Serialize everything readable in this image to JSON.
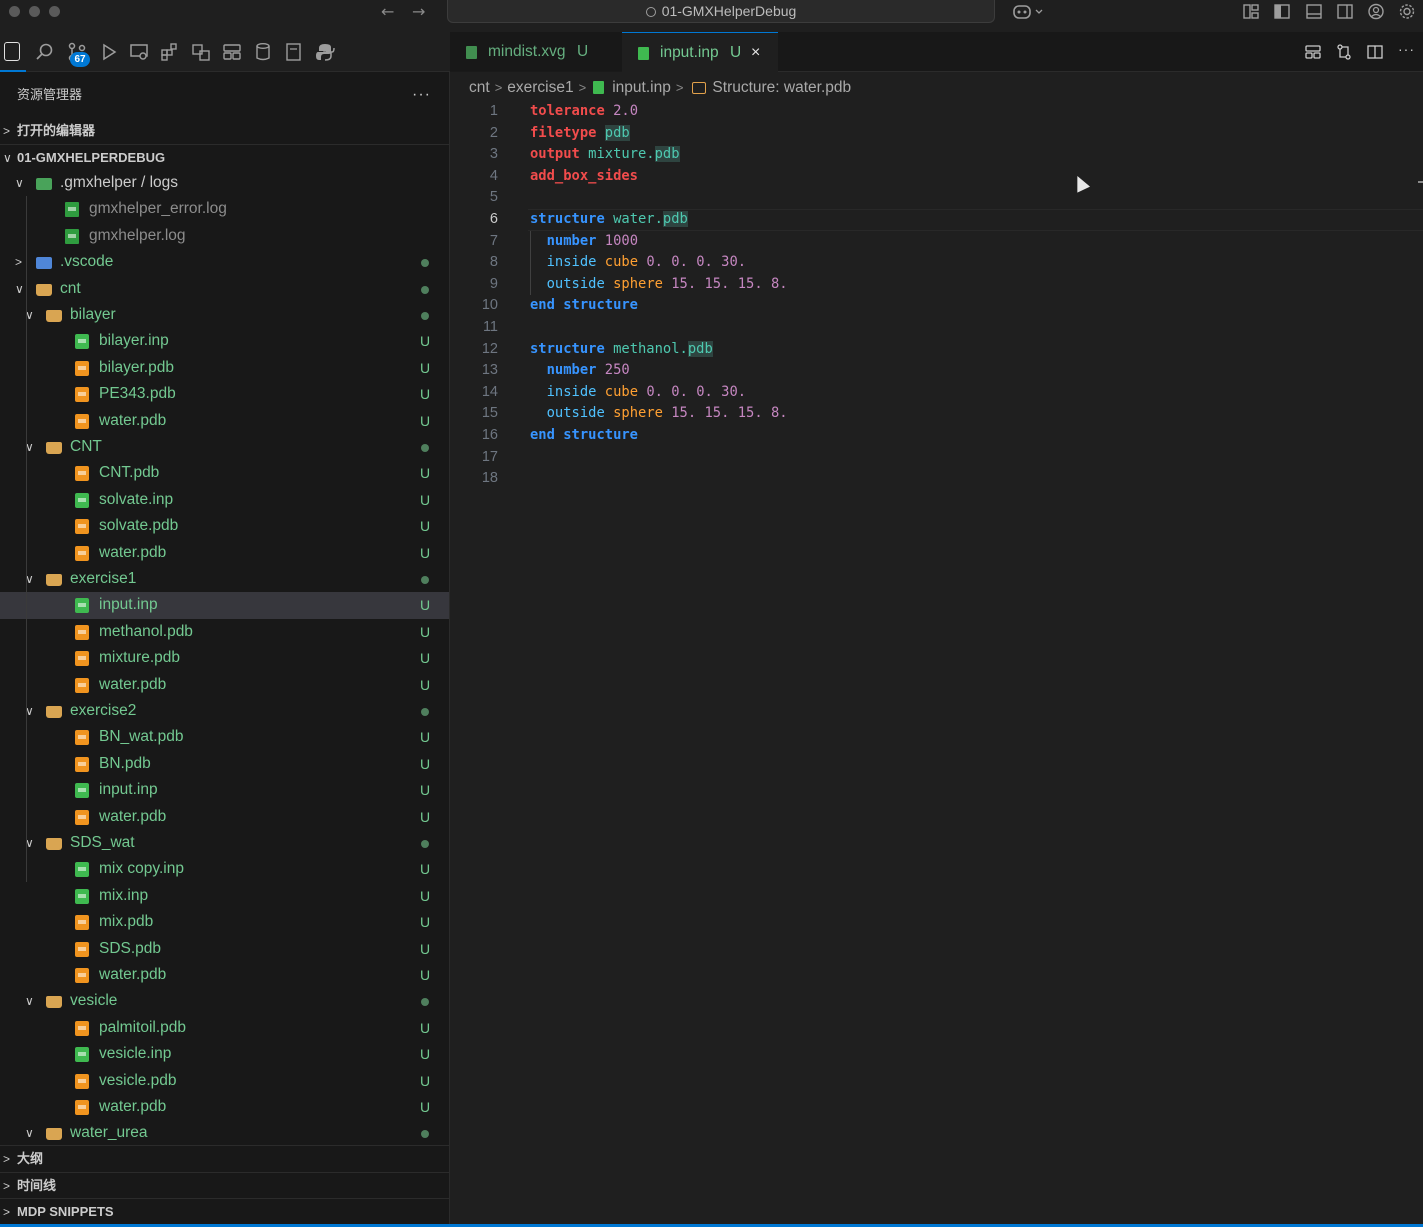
{
  "window": {
    "title": "01-GMXHelperDebug"
  },
  "activity_bar": {
    "source_control_badge": "67",
    "icons": [
      "files-icon",
      "search-icon",
      "source-control-icon",
      "run-debug-icon",
      "remote-explorer-icon",
      "extensions-icon",
      "testing-icon",
      "layout-icon",
      "database-icon",
      "notebook-icon",
      "python-icon"
    ]
  },
  "sidebar": {
    "title": "资源管理器",
    "more": "···",
    "open_editors": "打开的编辑器",
    "workspace": "01-GMXHELPERDEBUG",
    "tree": [
      {
        "label": ".gmxhelper / logs",
        "kind": "folder-green",
        "depth": 0,
        "expanded": true,
        "color": "plain"
      },
      {
        "label": "gmxhelper_error.log",
        "kind": "log",
        "depth": 1,
        "color": "gray"
      },
      {
        "label": "gmxhelper.log",
        "kind": "log",
        "depth": 1,
        "color": "gray"
      },
      {
        "label": ".vscode",
        "kind": "folder-blue",
        "depth": 0,
        "expanded": false,
        "color": "green",
        "dot": true
      },
      {
        "label": "cnt",
        "kind": "folder",
        "depth": 0,
        "expanded": true,
        "color": "green",
        "dot": true
      },
      {
        "label": "bilayer",
        "kind": "folder",
        "depth": 1,
        "expanded": true,
        "color": "green",
        "dot": true
      },
      {
        "label": "bilayer.inp",
        "kind": "inp",
        "depth": 2,
        "color": "green",
        "status": "U"
      },
      {
        "label": "bilayer.pdb",
        "kind": "pdb",
        "depth": 2,
        "color": "green",
        "status": "U"
      },
      {
        "label": "PE343.pdb",
        "kind": "pdb",
        "depth": 2,
        "color": "green",
        "status": "U"
      },
      {
        "label": "water.pdb",
        "kind": "pdb",
        "depth": 2,
        "color": "green",
        "status": "U"
      },
      {
        "label": "CNT",
        "kind": "folder",
        "depth": 1,
        "expanded": true,
        "color": "green",
        "dot": true
      },
      {
        "label": "CNT.pdb",
        "kind": "pdb",
        "depth": 2,
        "color": "green",
        "status": "U"
      },
      {
        "label": "solvate.inp",
        "kind": "inp",
        "depth": 2,
        "color": "green",
        "status": "U"
      },
      {
        "label": "solvate.pdb",
        "kind": "pdb",
        "depth": 2,
        "color": "green",
        "status": "U"
      },
      {
        "label": "water.pdb",
        "kind": "pdb",
        "depth": 2,
        "color": "green",
        "status": "U"
      },
      {
        "label": "exercise1",
        "kind": "folder",
        "depth": 1,
        "expanded": true,
        "color": "green",
        "dot": true
      },
      {
        "label": "input.inp",
        "kind": "inp",
        "depth": 2,
        "color": "green",
        "status": "U",
        "selected": true
      },
      {
        "label": "methanol.pdb",
        "kind": "pdb",
        "depth": 2,
        "color": "green",
        "status": "U"
      },
      {
        "label": "mixture.pdb",
        "kind": "pdb",
        "depth": 2,
        "color": "green",
        "status": "U"
      },
      {
        "label": "water.pdb",
        "kind": "pdb",
        "depth": 2,
        "color": "green",
        "status": "U"
      },
      {
        "label": "exercise2",
        "kind": "folder",
        "depth": 1,
        "expanded": true,
        "color": "green",
        "dot": true
      },
      {
        "label": "BN_wat.pdb",
        "kind": "pdb",
        "depth": 2,
        "color": "green",
        "status": "U"
      },
      {
        "label": "BN.pdb",
        "kind": "pdb",
        "depth": 2,
        "color": "green",
        "status": "U"
      },
      {
        "label": "input.inp",
        "kind": "inp",
        "depth": 2,
        "color": "green",
        "status": "U"
      },
      {
        "label": "water.pdb",
        "kind": "pdb",
        "depth": 2,
        "color": "green",
        "status": "U"
      },
      {
        "label": "SDS_wat",
        "kind": "folder",
        "depth": 1,
        "expanded": true,
        "color": "green",
        "dot": true
      },
      {
        "label": "mix copy.inp",
        "kind": "inp",
        "depth": 2,
        "color": "green",
        "status": "U"
      },
      {
        "label": "mix.inp",
        "kind": "inp",
        "depth": 2,
        "color": "green",
        "status": "U"
      },
      {
        "label": "mix.pdb",
        "kind": "pdb",
        "depth": 2,
        "color": "green",
        "status": "U"
      },
      {
        "label": "SDS.pdb",
        "kind": "pdb",
        "depth": 2,
        "color": "green",
        "status": "U"
      },
      {
        "label": "water.pdb",
        "kind": "pdb",
        "depth": 2,
        "color": "green",
        "status": "U"
      },
      {
        "label": "vesicle",
        "kind": "folder",
        "depth": 1,
        "expanded": true,
        "color": "green",
        "dot": true
      },
      {
        "label": "palmitoil.pdb",
        "kind": "pdb",
        "depth": 2,
        "color": "green",
        "status": "U"
      },
      {
        "label": "vesicle.inp",
        "kind": "inp",
        "depth": 2,
        "color": "green",
        "status": "U"
      },
      {
        "label": "vesicle.pdb",
        "kind": "pdb",
        "depth": 2,
        "color": "green",
        "status": "U"
      },
      {
        "label": "water.pdb",
        "kind": "pdb",
        "depth": 2,
        "color": "green",
        "status": "U"
      },
      {
        "label": "water_urea",
        "kind": "folder",
        "depth": 1,
        "expanded": true,
        "color": "green",
        "dot": true
      }
    ],
    "outline": "大纲",
    "timeline": "时间线",
    "snippets": "MDP SNIPPETS"
  },
  "tabs": [
    {
      "label": "mindist.xvg",
      "status": "U",
      "active": false
    },
    {
      "label": "input.inp",
      "status": "U",
      "active": true,
      "close": "×"
    }
  ],
  "breadcrumbs": {
    "parts": [
      "cnt",
      "exercise1",
      "input.inp"
    ],
    "symbol": "Structure: water.pdb"
  },
  "code": {
    "current_line": 6,
    "lines": [
      [
        [
          "tolerance",
          "k-red"
        ],
        [
          " ",
          "k-plain"
        ],
        [
          "2.0",
          "k-purple"
        ]
      ],
      [
        [
          "filetype",
          "k-red"
        ],
        [
          " ",
          "k-plain"
        ],
        [
          "pdb",
          "hl"
        ]
      ],
      [
        [
          "output",
          "k-red"
        ],
        [
          " ",
          "k-plain"
        ],
        [
          "mixture.",
          "k-teal"
        ],
        [
          "pdb",
          "hl"
        ]
      ],
      [
        [
          "add_box_sides",
          "k-red"
        ]
      ],
      [],
      [
        [
          "structure",
          "k-blue"
        ],
        [
          " ",
          "k-plain"
        ],
        [
          "water.",
          "k-teal"
        ],
        [
          "pdb",
          "hl"
        ]
      ],
      [
        [
          "  ",
          "guide"
        ],
        [
          "number",
          "k-blue"
        ],
        [
          " ",
          "k-plain"
        ],
        [
          "1000",
          "k-purple"
        ]
      ],
      [
        [
          "  ",
          "guide"
        ],
        [
          "inside",
          "k-blue2"
        ],
        [
          " ",
          "k-plain"
        ],
        [
          "cube",
          "k-orange"
        ],
        [
          " ",
          "k-plain"
        ],
        [
          "0.",
          "k-purple"
        ],
        [
          " ",
          "k-plain"
        ],
        [
          "0.",
          "k-purple"
        ],
        [
          " ",
          "k-plain"
        ],
        [
          "0.",
          "k-purple"
        ],
        [
          " ",
          "k-plain"
        ],
        [
          "30.",
          "k-purple"
        ]
      ],
      [
        [
          "  ",
          "guide"
        ],
        [
          "outside",
          "k-blue2"
        ],
        [
          " ",
          "k-plain"
        ],
        [
          "sphere",
          "k-orange"
        ],
        [
          " ",
          "k-plain"
        ],
        [
          "15.",
          "k-purple"
        ],
        [
          " ",
          "k-plain"
        ],
        [
          "15.",
          "k-purple"
        ],
        [
          " ",
          "k-plain"
        ],
        [
          "15.",
          "k-purple"
        ],
        [
          " ",
          "k-plain"
        ],
        [
          "8.",
          "k-purple"
        ]
      ],
      [
        [
          "end",
          "k-blue"
        ],
        [
          " ",
          "k-plain"
        ],
        [
          "structure",
          "k-blue"
        ]
      ],
      [],
      [
        [
          "structure",
          "k-blue"
        ],
        [
          " ",
          "k-plain"
        ],
        [
          "methanol.",
          "k-teal"
        ],
        [
          "pdb",
          "hl"
        ]
      ],
      [
        [
          "  ",
          "plain"
        ],
        [
          "number",
          "k-blue"
        ],
        [
          " ",
          "k-plain"
        ],
        [
          "250",
          "k-purple"
        ]
      ],
      [
        [
          "  ",
          "plain"
        ],
        [
          "inside",
          "k-blue2"
        ],
        [
          " ",
          "k-plain"
        ],
        [
          "cube",
          "k-orange"
        ],
        [
          " ",
          "k-plain"
        ],
        [
          "0.",
          "k-purple"
        ],
        [
          " ",
          "k-plain"
        ],
        [
          "0.",
          "k-purple"
        ],
        [
          " ",
          "k-plain"
        ],
        [
          "0.",
          "k-purple"
        ],
        [
          " ",
          "k-plain"
        ],
        [
          "30.",
          "k-purple"
        ]
      ],
      [
        [
          "  ",
          "plain"
        ],
        [
          "outside",
          "k-blue2"
        ],
        [
          " ",
          "k-plain"
        ],
        [
          "sphere",
          "k-orange"
        ],
        [
          " ",
          "k-plain"
        ],
        [
          "15.",
          "k-purple"
        ],
        [
          " ",
          "k-plain"
        ],
        [
          "15.",
          "k-purple"
        ],
        [
          " ",
          "k-plain"
        ],
        [
          "15.",
          "k-purple"
        ],
        [
          " ",
          "k-plain"
        ],
        [
          "8.",
          "k-purple"
        ]
      ],
      [
        [
          "end",
          "k-blue"
        ],
        [
          " ",
          "k-plain"
        ],
        [
          "structure",
          "k-blue"
        ]
      ],
      [],
      []
    ]
  }
}
